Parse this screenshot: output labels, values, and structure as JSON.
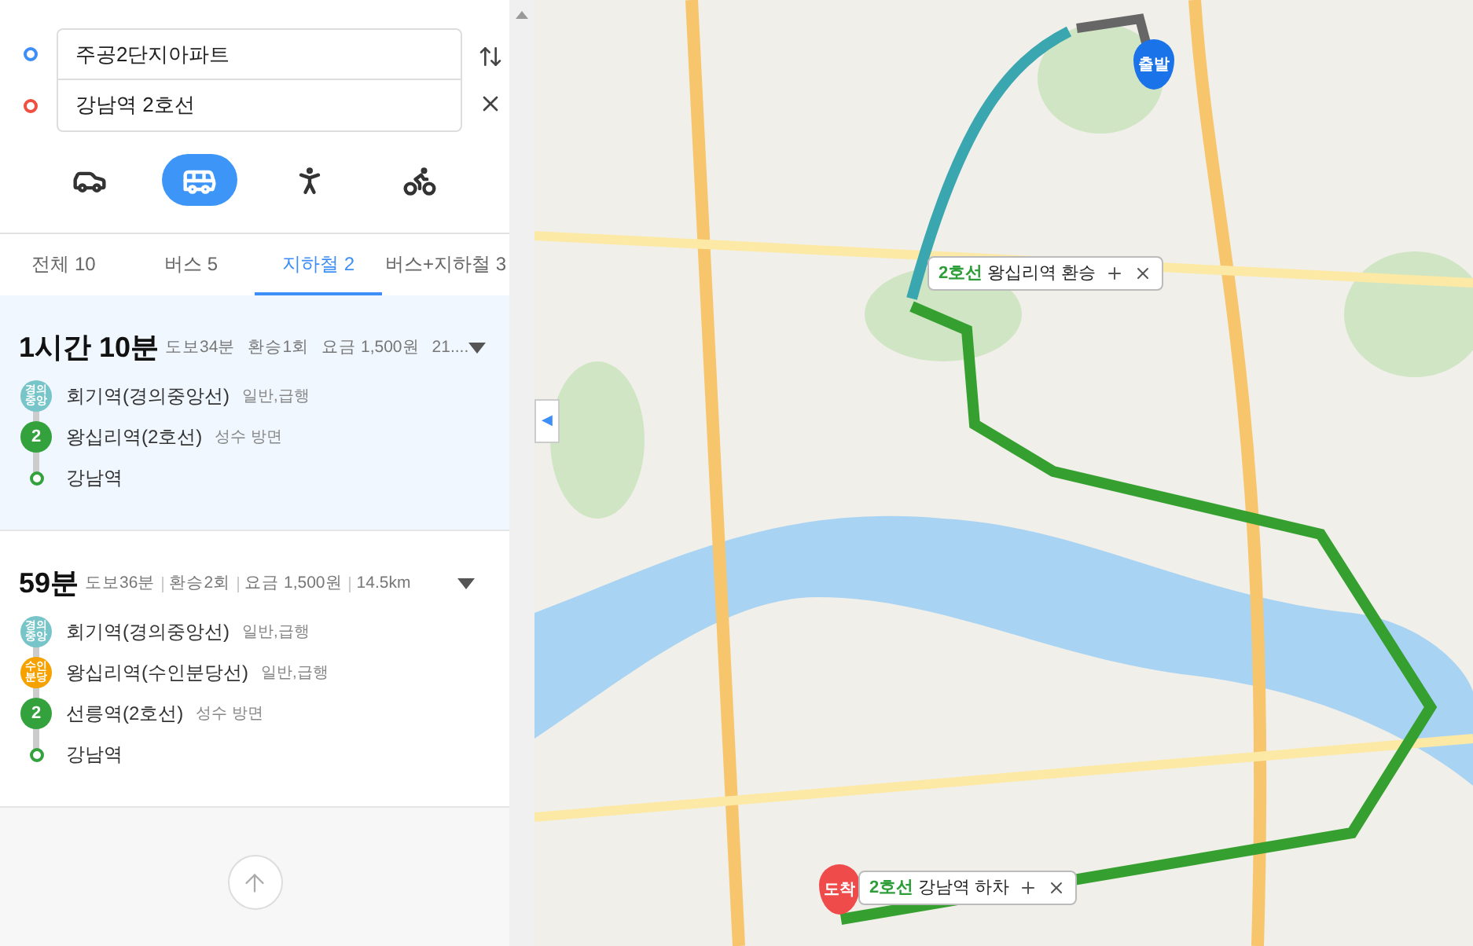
{
  "route_inputs": [
    {
      "kind": "origin",
      "value": "주공2단지아파트"
    },
    {
      "kind": "destination",
      "value": "강남역 2호선"
    }
  ],
  "modes": [
    {
      "kind": "car",
      "selected": false
    },
    {
      "kind": "bus",
      "selected": true
    },
    {
      "kind": "walk",
      "selected": false
    },
    {
      "kind": "bike",
      "selected": false
    }
  ],
  "tabs": [
    {
      "label": "전체 10",
      "selected": false
    },
    {
      "label": "버스 5",
      "selected": false
    },
    {
      "label": "지하철 2",
      "selected": true
    },
    {
      "label": "버스+지하철 3",
      "selected": false
    }
  ],
  "results": [
    {
      "selected": true,
      "duration": "1시간 10분",
      "details": [
        "도보34분",
        "환승1회",
        "요금 1,500원",
        "21...."
      ],
      "steps": [
        {
          "kind": "line",
          "badge": "경의\n중앙",
          "color": "#77c4c9",
          "station": "회기역(경의중앙선)",
          "note": "일반,급행"
        },
        {
          "kind": "line",
          "badge": "2",
          "color": "#33a23d",
          "station": "왕십리역(2호선)",
          "note": "성수 방면"
        },
        {
          "kind": "end",
          "color": "#33a23d",
          "station": "강남역"
        }
      ]
    },
    {
      "selected": false,
      "duration": "59분",
      "details": [
        "도보36분",
        "환승2회",
        "요금 1,500원",
        "14.5km"
      ],
      "steps": [
        {
          "kind": "line",
          "badge": "경의\n중앙",
          "color": "#77c4c9",
          "station": "회기역(경의중앙선)",
          "note": "일반,급행"
        },
        {
          "kind": "line",
          "badge": "수인\n분당",
          "color": "#f5a200",
          "station": "왕십리역(수인분당선)",
          "note": "일반,급행"
        },
        {
          "kind": "line",
          "badge": "2",
          "color": "#33a23d",
          "station": "선릉역(2호선)",
          "note": "성수 방면"
        },
        {
          "kind": "end",
          "color": "#33a23d",
          "station": "강남역"
        }
      ]
    }
  ],
  "collapse_glyph": "◀",
  "map": {
    "markers": [
      {
        "kind": "start",
        "label": "출발"
      },
      {
        "kind": "end",
        "label": "도착"
      }
    ],
    "callouts": [
      {
        "line": "2호선",
        "text": "왕십리역 환승"
      },
      {
        "line": "2호선",
        "text": "강남역 하차"
      }
    ]
  }
}
